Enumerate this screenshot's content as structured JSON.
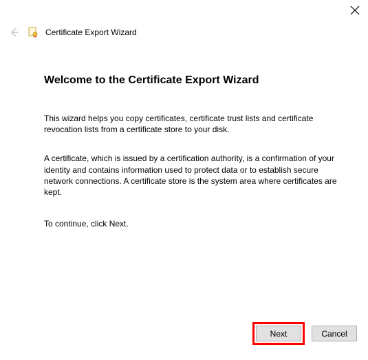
{
  "window": {
    "close_icon": "close",
    "back_icon": "back",
    "wizard_icon": "certificate",
    "title": "Certificate Export Wizard"
  },
  "content": {
    "heading": "Welcome to the Certificate Export Wizard",
    "paragraph1": "This wizard helps you copy certificates, certificate trust lists and certificate revocation lists from a certificate store to your disk.",
    "paragraph2": "A certificate, which is issued by a certification authority, is a confirmation of your identity and contains information used to protect data or to establish secure network connections. A certificate store is the system area where certificates are kept.",
    "paragraph3": "To continue, click Next."
  },
  "footer": {
    "next_label": "Next",
    "cancel_label": "Cancel"
  }
}
